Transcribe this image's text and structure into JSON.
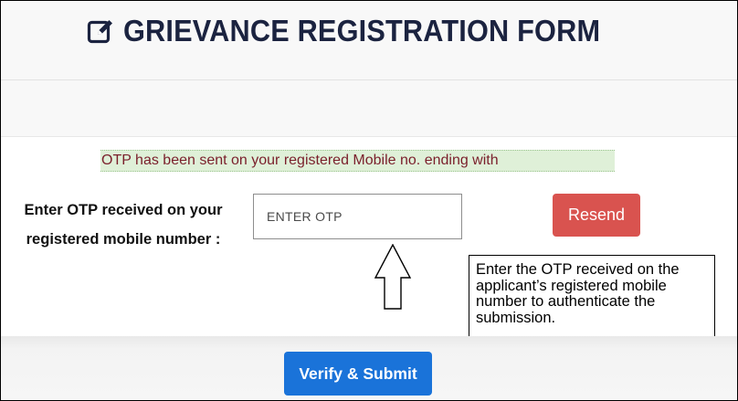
{
  "header": {
    "title": "GRIEVANCE REGISTRATION FORM",
    "icon": "edit-icon"
  },
  "otp_notice": {
    "message": "OTP has been sent on your registered Mobile no. ending with"
  },
  "otp_field": {
    "label_line1": "Enter OTP received on your",
    "label_line2": "registered mobile number :",
    "placeholder": "ENTER OTP",
    "value": ""
  },
  "buttons": {
    "resend_label": "Resend",
    "verify_label": "Verify & Submit"
  },
  "callout": {
    "text": "Enter the OTP received on the applicant’s registered mobile number to authenticate the submission."
  },
  "colors": {
    "title": "#1b2340",
    "notice_bg": "#dff0d8",
    "notice_text": "#7a1f2b",
    "resend_bg": "#d9534f",
    "verify_bg": "#1a73d9"
  }
}
